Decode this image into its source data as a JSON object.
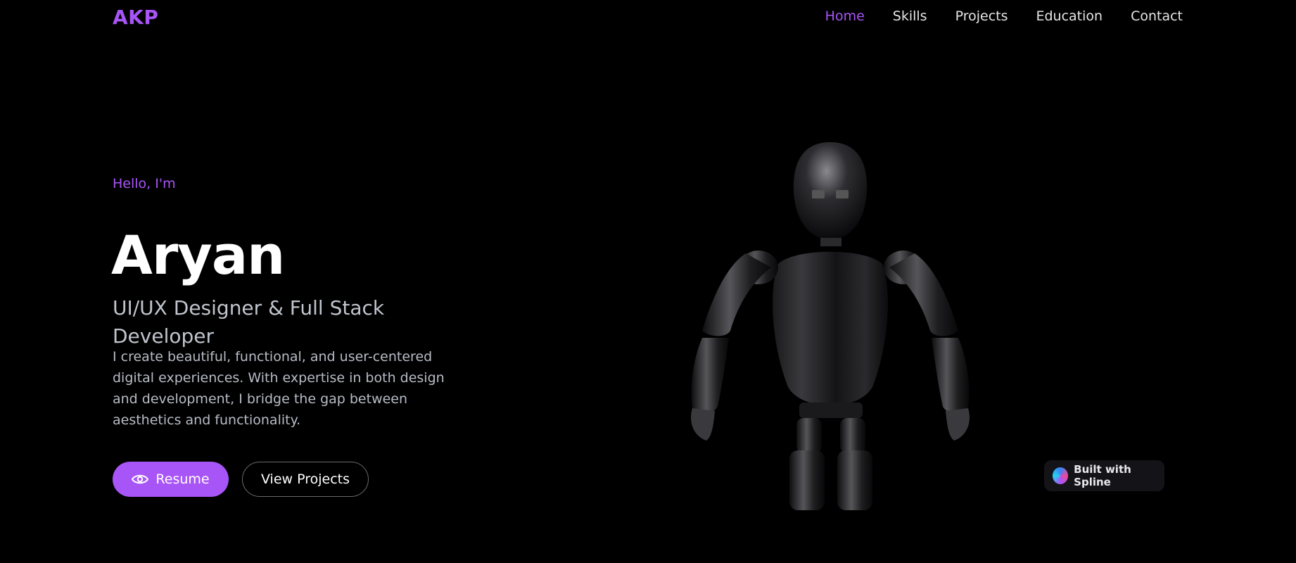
{
  "header": {
    "logo": "AKP",
    "nav": [
      "Home",
      "Skills",
      "Projects",
      "Education",
      "Contact"
    ],
    "active_nav": "Home"
  },
  "hero": {
    "greeting": "Hello, I'm",
    "name": "Aryan",
    "role": "UI/UX Designer & Full Stack Developer",
    "description": "I create beautiful, functional, and user-centered digital experiences. With expertise in both design and development, I bridge the gap between aesthetics and functionality.",
    "resume_label": "Resume",
    "projects_label": "View Projects"
  },
  "badge": {
    "label": "Built with Spline"
  },
  "icons": {
    "resume": "eye-icon",
    "badge": "spline-logo-icon"
  },
  "colors": {
    "accent": "#a855f7",
    "background": "#000000",
    "text_muted": "#b7bcc6"
  }
}
